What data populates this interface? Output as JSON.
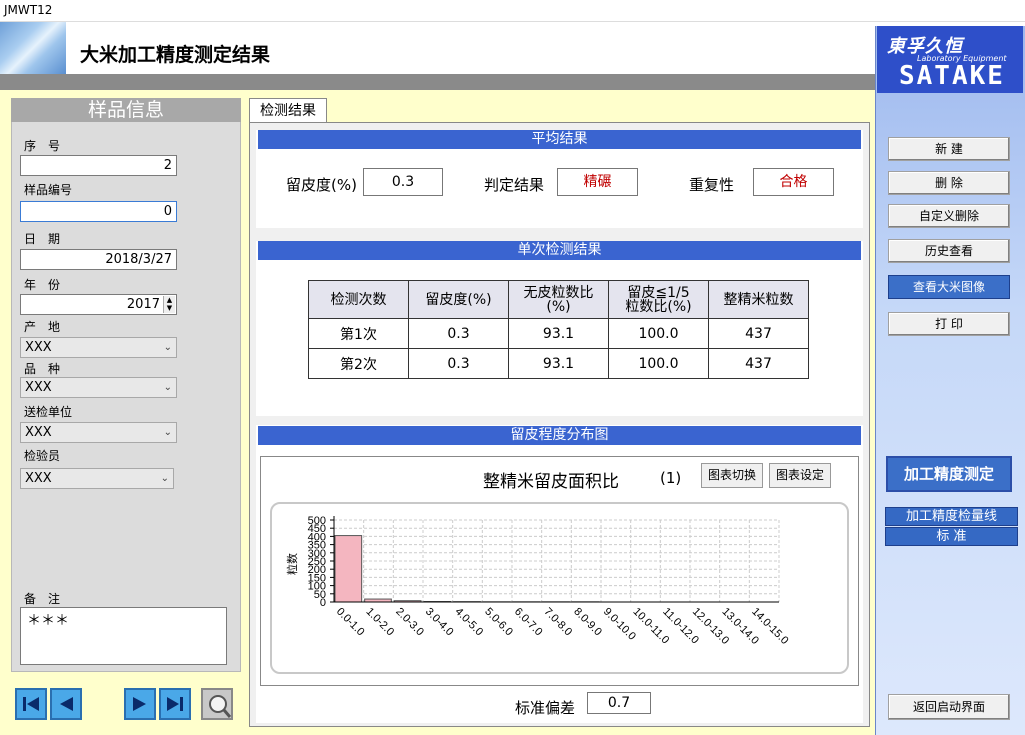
{
  "window": {
    "title": "JMWT12"
  },
  "header": {
    "title": "大米加工精度测定结果"
  },
  "brand": {
    "logo": "東孚久恒",
    "sub": "Laboratory Equipment",
    "name": "SATAKE"
  },
  "right_panel": {
    "buttons": [
      "新 建",
      "删 除",
      "自定义删除",
      "历史查看",
      "查看大米图像",
      "打 印"
    ],
    "precision_button": "加工精度测定",
    "links": [
      "加工精度检量线",
      "标 准"
    ],
    "return_button": "返回启动界面"
  },
  "sample": {
    "heading": "样品信息",
    "seq_label": "序　号",
    "seq_value": "2",
    "code_label": "样品编号",
    "code_value": "0",
    "date_label": "日　期",
    "date_value": "2018/3/27",
    "year_label": "年　份",
    "year_value": "2017",
    "origin_label": "产　地",
    "origin_value": "ⅩⅩⅩ",
    "variety_label": "品　种",
    "variety_value": "ⅩⅩⅩ",
    "unit_label": "送检单位",
    "unit_value": "ⅩⅩⅩ",
    "inspector_label": "检验员",
    "inspector_value": "ⅩⅩⅩ",
    "notes_label": "备　注",
    "notes_value": "＊＊＊"
  },
  "tab": {
    "label": "检测结果"
  },
  "average": {
    "heading": "平均结果",
    "bran_label": "留皮度(%)",
    "bran_value": "0.3",
    "judge_label": "判定结果",
    "judge_value": "精碾",
    "repeat_label": "重复性",
    "repeat_value": "合格"
  },
  "single": {
    "heading": "单次检测结果",
    "columns": [
      "检测次数",
      "留皮度(%)",
      "无皮粒数比\n(%)",
      "留皮≦1/5\n粒数比(%)",
      "整精米粒数"
    ],
    "rows": [
      [
        "第1次",
        "0.3",
        "93.1",
        "100.0",
        "437"
      ],
      [
        "第2次",
        "0.3",
        "93.1",
        "100.0",
        "437"
      ]
    ]
  },
  "distribution": {
    "heading": "留皮程度分布图",
    "chart_title": "整精米留皮面积比",
    "chart_index": "(1)",
    "switch_label": "图表切换",
    "settings_label": "图表设定",
    "std_label": "标准偏差",
    "std_value": "0.7"
  },
  "chart_data": {
    "type": "bar",
    "categories": [
      "0.0-1.0",
      "1.0-2.0",
      "2.0-3.0",
      "3.0-4.0",
      "4.0-5.0",
      "5.0-6.0",
      "6.0-7.0",
      "7.0-8.0",
      "8.0-9.0",
      "9.0-10.0",
      "10.0-11.0",
      "11.0-12.0",
      "12.0-13.0",
      "13.0-14.0",
      "14.0-15.0"
    ],
    "values": [
      405,
      18,
      8,
      3,
      2,
      1,
      1,
      1,
      1,
      0,
      0,
      0,
      0,
      0,
      0
    ],
    "ylabel": "粒数",
    "ylim": [
      0,
      500
    ],
    "yticks": [
      0,
      50,
      100,
      150,
      200,
      250,
      300,
      350,
      400,
      450,
      500
    ],
    "grid": true,
    "colors": {
      "bar": "#f4b6c0"
    }
  }
}
